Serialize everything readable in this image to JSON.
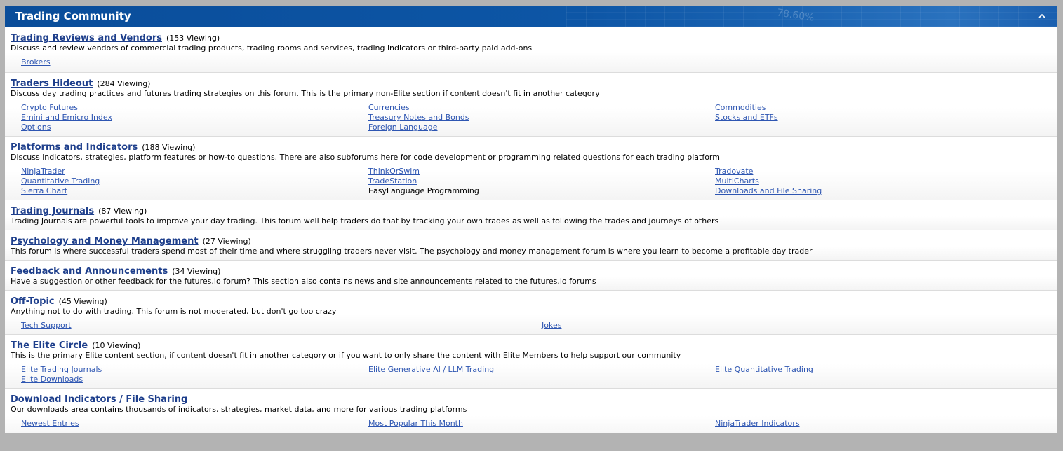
{
  "header": {
    "title": "Trading Community",
    "watermark": "78.60%"
  },
  "forums": [
    {
      "title": "Trading Reviews and Vendors",
      "viewing": "(153 Viewing)",
      "description": "Discuss and review vendors of commercial trading products, trading rooms and services, trading indicators or third-party paid add-ons",
      "subforums": [
        "Brokers"
      ]
    },
    {
      "title": "Traders Hideout",
      "viewing": "(284 Viewing)",
      "description": "Discuss day trading practices and futures trading strategies on this forum. This is the primary non-Elite section if content doesn't fit in another category",
      "subforums": [
        "Crypto Futures",
        "Currencies",
        "Commodities",
        "Emini and Emicro Index",
        "Treasury Notes and Bonds",
        "Stocks and ETFs",
        "Options",
        "Foreign Language"
      ]
    },
    {
      "title": "Platforms and Indicators",
      "viewing": "(188 Viewing)",
      "description": "Discuss indicators, strategies, platform features or how-to questions. There are also subforums here for code development or programming related questions for each trading platform",
      "subforums": [
        "NinjaTrader",
        "ThinkOrSwim",
        "Tradovate",
        "Quantitative Trading",
        "TradeStation",
        "MultiCharts",
        "Sierra Chart",
        "EasyLanguage Programming",
        "Downloads and File Sharing"
      ]
    },
    {
      "title": "Trading Journals",
      "viewing": "(87 Viewing)",
      "description": "Trading Journals are powerful tools to improve your day trading. This forum well help traders do that by tracking your own trades as well as following the trades and journeys of others",
      "subforums": []
    },
    {
      "title": "Psychology and Money Management",
      "viewing": "(27 Viewing)",
      "description": "This forum is where successful traders spend most of their time and where struggling traders never visit. The psychology and money management forum is where you learn to become a profitable day trader",
      "subforums": []
    },
    {
      "title": "Feedback and Announcements",
      "viewing": "(34 Viewing)",
      "description": "Have a suggestion or other feedback for the futures.io forum? This section also contains news and site announcements related to the futures.io forums",
      "subforums": []
    },
    {
      "title": "Off-Topic",
      "viewing": "(45 Viewing)",
      "description": "Anything not to do with trading. This forum is not moderated, but don't go too crazy",
      "subforums": [
        "Tech Support",
        "Jokes"
      ]
    },
    {
      "title": "The Elite Circle",
      "viewing": "(10 Viewing)",
      "description": "This is the primary Elite content section, if content doesn't fit in another category or if you want to only share the content with Elite Members to help support our community",
      "subforums": [
        "Elite Trading Journals",
        "Elite Generative AI / LLM Trading",
        "Elite Quantitative Trading",
        "Elite Downloads"
      ]
    },
    {
      "title": "Download Indicators / File Sharing",
      "viewing": "",
      "description": "Our downloads area contains thousands of indicators, strategies, market data, and more for various trading platforms",
      "subforums": [
        "Newest Entries",
        "Most Popular This Month",
        "NinjaTrader Indicators"
      ]
    }
  ]
}
